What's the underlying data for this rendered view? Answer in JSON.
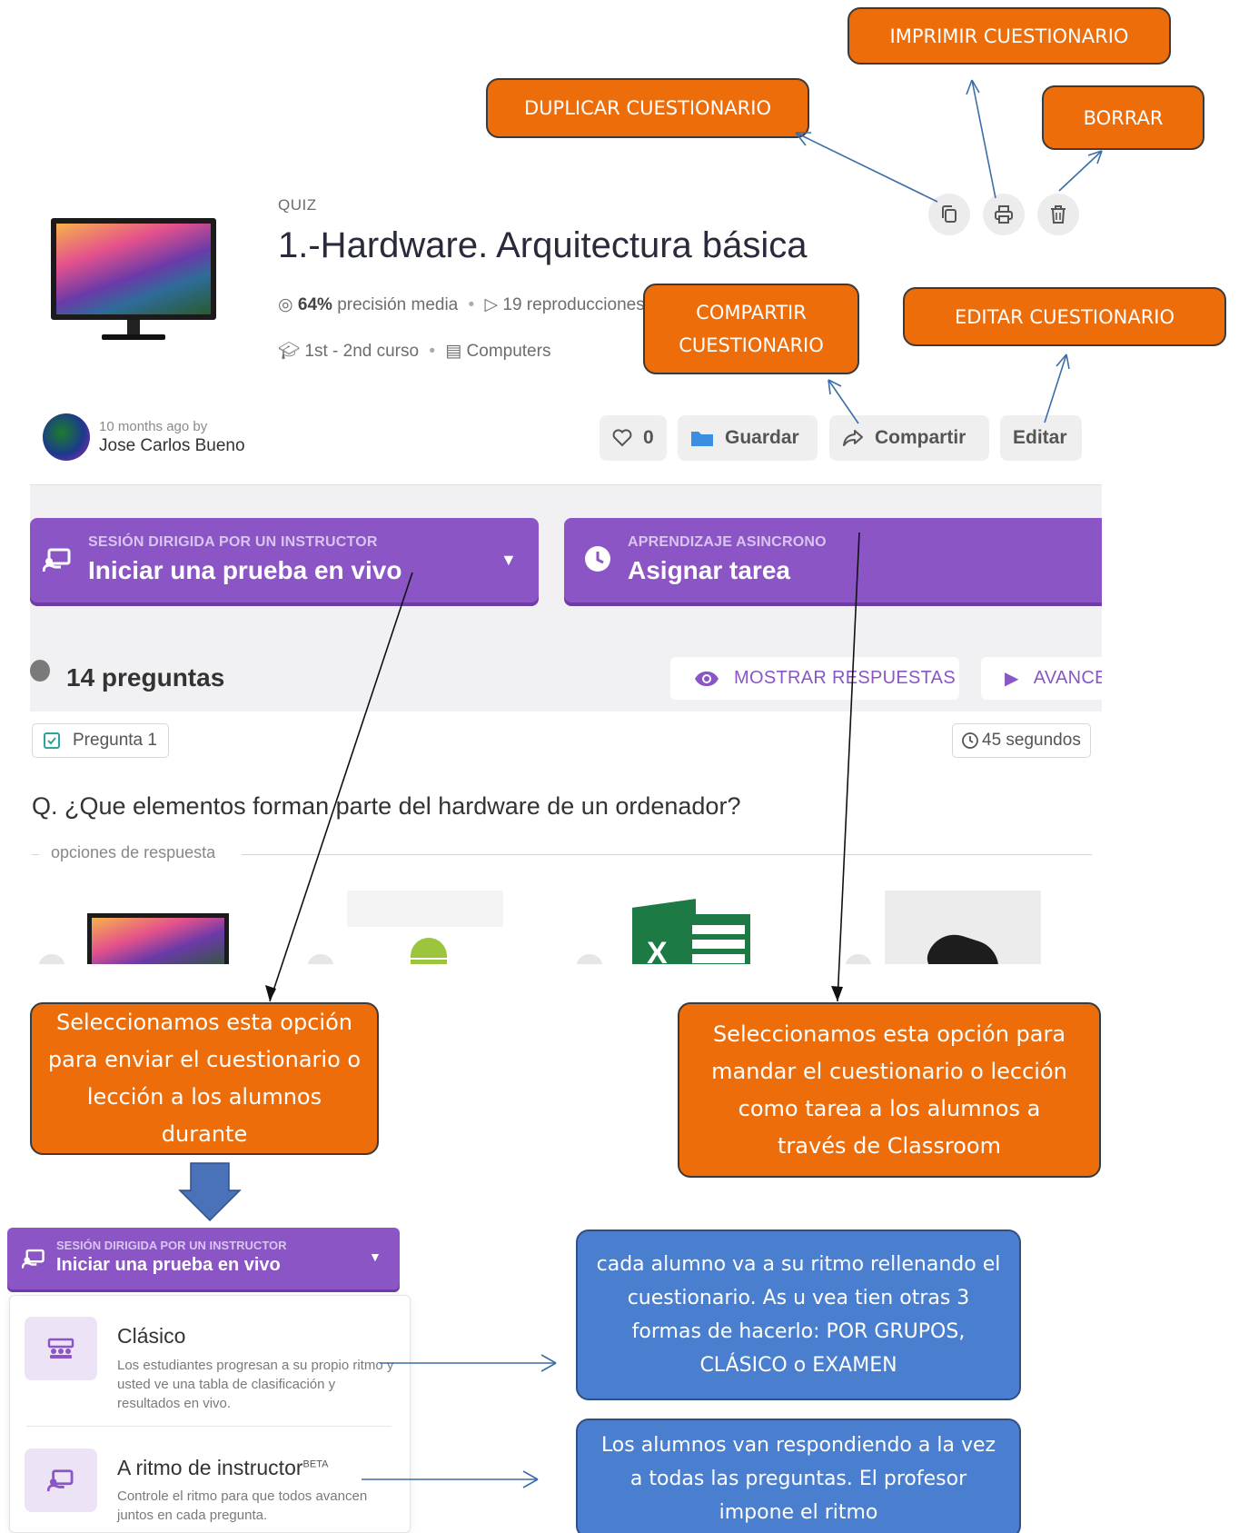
{
  "quiz": {
    "type_label": "QUIZ",
    "title": "1.-Hardware. Arquitectura básica",
    "accuracy_value": "64%",
    "accuracy_label": "precisión media",
    "plays": "19 reproducciones",
    "grade": "1st - 2nd curso",
    "subject": "Computers"
  },
  "author": {
    "when": "10 months ago by",
    "name": "Jose Carlos Bueno"
  },
  "actions": {
    "likes": "0",
    "save": "Guardar",
    "share": "Compartir",
    "edit": "Editar"
  },
  "sessions": {
    "live_small": "SESIÓN DIRIGIDA POR UN INSTRUCTOR",
    "live_big": "Iniciar una prueba en vivo",
    "async_small": "APRENDIZAJE ASINCRONO",
    "async_big": "Asignar tarea"
  },
  "questions": {
    "count": "14 preguntas",
    "show_answers": "MOSTRAR RESPUESTAS",
    "preview": "AVANCE",
    "q1_label": "Pregunta 1",
    "q1_time": "45 segundos",
    "q1_text": "Q. ¿Que elementos forman parte del hardware de un ordenador?",
    "options_label": "opciones de respuesta"
  },
  "callouts": {
    "print": "IMPRIMIR CUESTIONARIO",
    "duplicate": "DUPLICAR CUESTIONARIO",
    "delete": "BORRAR",
    "share": "COMPARTIR CUESTIONARIO",
    "edit": "EDITAR CUESTIONARIO",
    "live_note": "Seleccionamos esta opción para enviar el cuestionario o lección a los alumnos durante",
    "async_note": "Seleccionamos esta opción para mandar el cuestionario o lección como tarea a los alumnos a través de Classroom",
    "classic_note": "cada alumno va a su ritmo rellenando el cuestionario. As u vea tien otras 3 formas de hacerlo: POR GRUPOS, CLÁSICO o EXAMEN",
    "paced_note": "Los alumnos van respondiendo a la vez a todas las preguntas. El profesor impone el ritmo"
  },
  "dropdown": {
    "small": "SESIÓN DIRIGIDA POR UN INSTRUCTOR",
    "big": "Iniciar una prueba en vivo",
    "classic_title": "Clásico",
    "classic_desc": "Los estudiantes progresan a su propio ritmo y usted ve una tabla de clasificación y resultados en vivo.",
    "paced_title": "A ritmo de instructor",
    "paced_badge": "BETA",
    "paced_desc": "Controle el ritmo para que todos avancen juntos en cada pregunta."
  },
  "colors": {
    "orange": "#ed6d0b",
    "purple": "#8b55c6",
    "blue": "#4a7fd0"
  }
}
